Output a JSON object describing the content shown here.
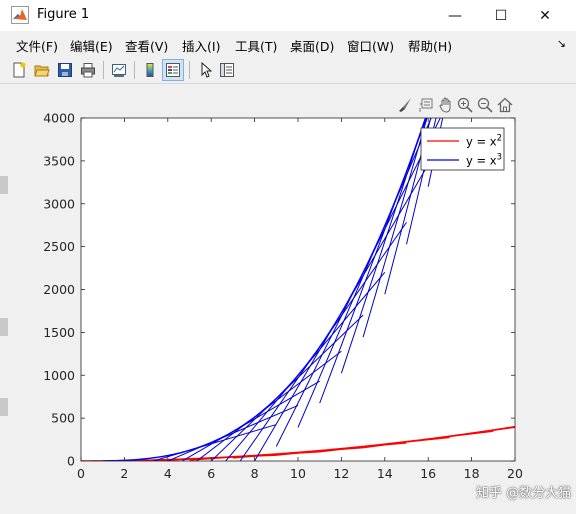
{
  "window": {
    "title": "Figure 1",
    "controls": {
      "minimize": "—",
      "maximize": "☐",
      "close": "✕"
    }
  },
  "menu": {
    "items": [
      {
        "label": "文件(F)"
      },
      {
        "label": "编辑(E)"
      },
      {
        "label": "查看(V)"
      },
      {
        "label": "插入(I)"
      },
      {
        "label": "工具(T)"
      },
      {
        "label": "桌面(D)"
      },
      {
        "label": "窗口(W)"
      },
      {
        "label": "帮助(H)"
      }
    ],
    "overflow_arrow": "↘"
  },
  "toolbar": {
    "buttons": [
      {
        "icon": "new-figure-icon"
      },
      {
        "icon": "open-file-icon"
      },
      {
        "icon": "save-icon"
      },
      {
        "icon": "print-icon"
      },
      {
        "icon": "link-plot-icon"
      },
      {
        "icon": "insert-colorbar-icon"
      },
      {
        "icon": "insert-legend-icon",
        "active": true
      },
      {
        "icon": "edit-plot-icon"
      },
      {
        "icon": "property-inspector-icon"
      }
    ]
  },
  "axes_toolbar": {
    "buttons": [
      "brush-icon",
      "data-tips-icon",
      "pan-icon",
      "zoom-in-icon",
      "zoom-out-icon",
      "home-icon"
    ]
  },
  "watermark": "知乎 @数分大猫",
  "colors": {
    "series_square": "#ff0000",
    "series_cube": "#0000ff",
    "tangent": "#0000c8",
    "axis": "#262626"
  },
  "chart_data": {
    "type": "line",
    "xlim": [
      0,
      20
    ],
    "ylim": [
      0,
      4000
    ],
    "xticks": [
      0,
      2,
      4,
      6,
      8,
      10,
      12,
      14,
      16,
      18,
      20
    ],
    "yticks": [
      0,
      500,
      1000,
      1500,
      2000,
      2500,
      3000,
      3500,
      4000
    ],
    "grid": false,
    "legend_location": "top-right",
    "series": [
      {
        "name": "y = x",
        "superscript": "2",
        "function": "x^2",
        "x_range": [
          0,
          20
        ],
        "color": "#ff0000"
      },
      {
        "name": "y = x",
        "superscript": "3",
        "function": "x^3",
        "x_range": [
          1,
          16
        ],
        "color": "#0000ff"
      }
    ],
    "tangent_points_x": [
      5,
      6,
      7,
      8,
      9,
      10,
      11,
      12,
      13,
      14,
      15,
      16,
      17,
      18,
      19,
      20
    ],
    "tangent_half_length_x": 4,
    "red_tangent_points_x": [
      5,
      7,
      9,
      11,
      13,
      15,
      17
    ]
  }
}
